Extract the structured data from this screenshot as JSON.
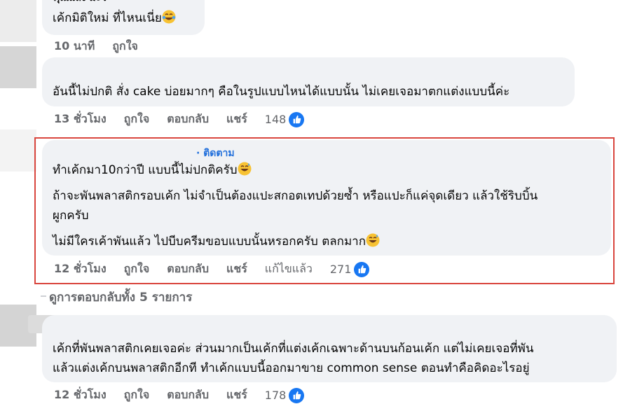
{
  "comment1": {
    "partial_name": "คุณแลง มะว่",
    "text": "เค้กมิติใหม่ ที่ไหนเนี่ย",
    "emoji": "crying-laughing",
    "time": "10 นาที",
    "like": "ถูกใจ"
  },
  "comment2": {
    "text": "อันนี้ไม่ปกติ สั่ง cake บ่อยมากๆ คือในรูปแบบไหนได้แบบนั้น ไม่เคยเจอมาตกแต่งแบบนี้ค่ะ",
    "time": "13 ชั่วโมง",
    "like": "ถูกใจ",
    "reply": "ตอบกลับ",
    "share": "แชร์",
    "likes": "148"
  },
  "comment3": {
    "follow": "· ติดตาม",
    "line1": "ทำเค้กมา10กว่าปี แบบนี้ไม่ปกติครับ",
    "line2a": "ถ้าจะพันพลาสติกรอบเค้ก ไม่จำเป็นต้องแปะสกอตเทปด้วยซ้ำ หรือแปะก็แค่จุดเดียว แล้วใช้ริบบิ้น",
    "line2b": "ผูกครับ",
    "line3": "ไม่มีใครเค้าพันแล้ว ไปบีบครีมขอบแบบนั้นหรอกครับ ตลกมาก",
    "time": "12 ชั่วโมง",
    "like": "ถูกใจ",
    "reply": "ตอบกลับ",
    "share": "แชร์",
    "edited": "แก้ไขแล้ว",
    "likes": "271"
  },
  "view_replies": "ดูการตอบกลับทั้ง 5 รายการ",
  "comment4": {
    "line1": "เค้กที่พันพลาสติกเคยเจอค่ะ ส่วนมากเป็นเค้กที่แต่งเค้กเฉพาะด้านบนก้อนเค้ก แต่ไม่เคยเจอที่พัน",
    "line2": "แล้วแต่งเค้กบนพลาสติกอีกที ทำเค้กแบบนี้ออกมาขาย common sense ตอนทำคือคิดอะไรอยู่",
    "time": "12 ชั่วโมง",
    "like": "ถูกใจ",
    "reply": "ตอบกลับ",
    "share": "แชร์",
    "likes": "178"
  },
  "colors": {
    "bubble": "#f0f2f5",
    "meta": "#65676b",
    "link": "#216fdb",
    "like_blue": "#1877f2",
    "highlight": "#d9463e"
  }
}
